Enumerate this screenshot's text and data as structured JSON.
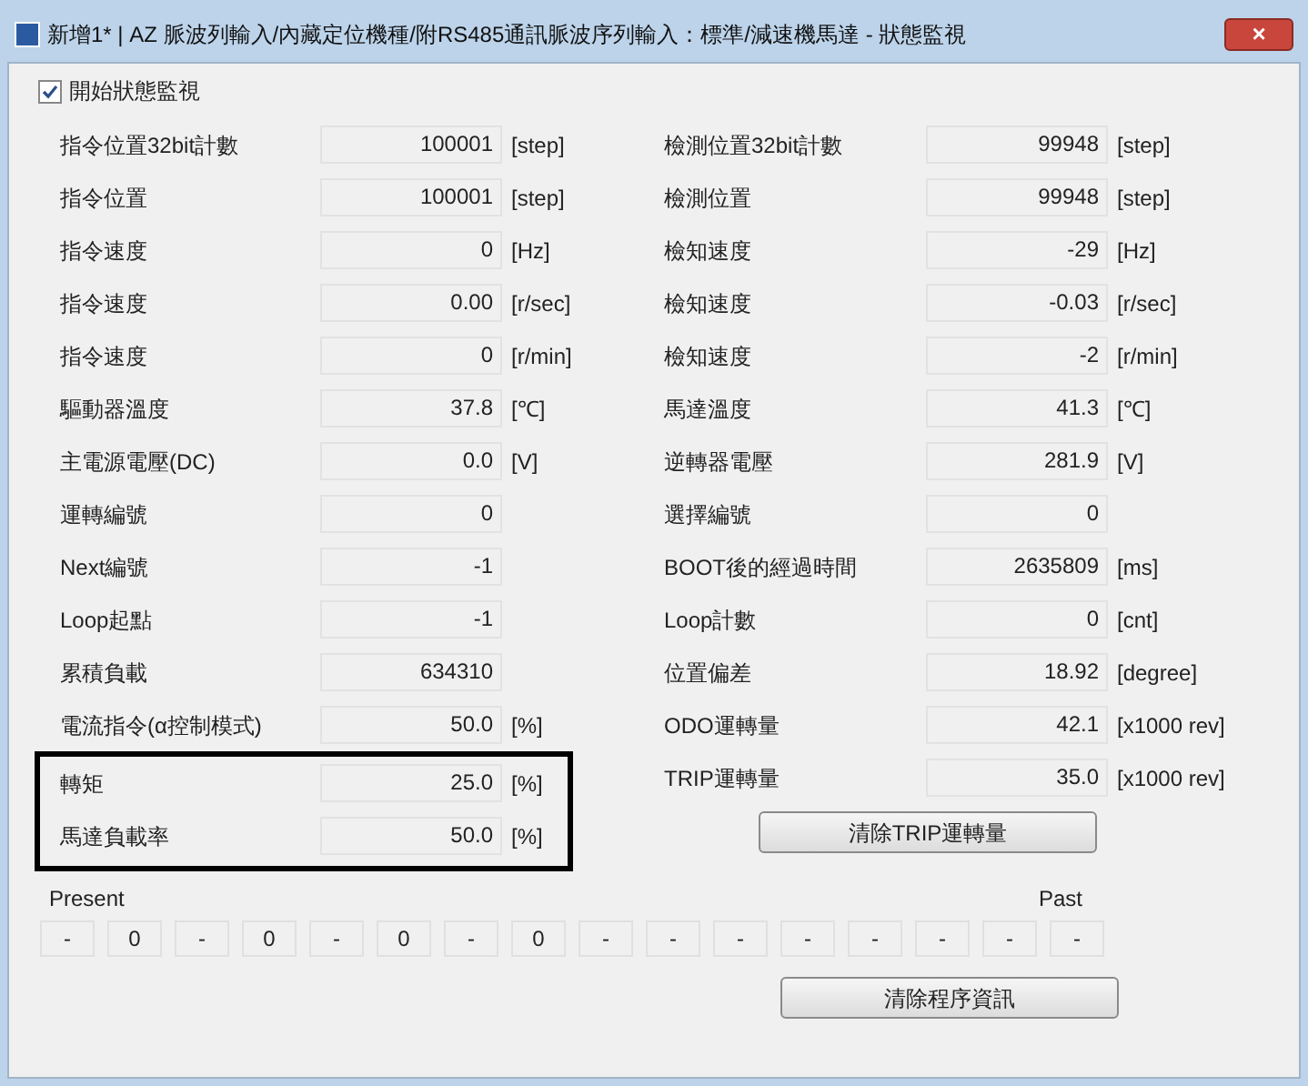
{
  "window": {
    "title": "新增1* | AZ 脈波列輸入/內藏定位機種/附RS485通訊脈波序列輸入：標準/減速機馬達 - 狀態監視",
    "close": "×"
  },
  "monitor_checkbox": {
    "label": "開始狀態監視",
    "checked": true
  },
  "left_rows": [
    {
      "label": "指令位置32bit計數",
      "value": "100001",
      "unit": "[step]",
      "highlighted": false
    },
    {
      "label": "指令位置",
      "value": "100001",
      "unit": "[step]",
      "highlighted": false
    },
    {
      "label": "指令速度",
      "value": "0",
      "unit": "[Hz]",
      "highlighted": false
    },
    {
      "label": "指令速度",
      "value": "0.00",
      "unit": "[r/sec]",
      "highlighted": false
    },
    {
      "label": "指令速度",
      "value": "0",
      "unit": "[r/min]",
      "highlighted": false
    },
    {
      "label": "驅動器溫度",
      "value": "37.8",
      "unit": "[℃]",
      "highlighted": false
    },
    {
      "label": "主電源電壓(DC)",
      "value": "0.0",
      "unit": "[V]",
      "highlighted": false
    },
    {
      "label": "運轉編號",
      "value": "0",
      "highlighted": false
    },
    {
      "label": "Next編號",
      "value": "-1",
      "highlighted": false
    },
    {
      "label": "Loop起點",
      "value": "-1",
      "highlighted": false
    },
    {
      "label": "累積負載",
      "value": "634310",
      "highlighted": false
    },
    {
      "label": "電流指令(α控制模式)",
      "value": "50.0",
      "unit": "[%]",
      "highlighted": false
    },
    {
      "label": "轉矩",
      "value": "25.0",
      "unit": "[%]",
      "highlighted": true
    },
    {
      "label": "馬達負載率",
      "value": "50.0",
      "unit": "[%]",
      "highlighted": true
    }
  ],
  "right_rows": [
    {
      "label": "檢測位置32bit計數",
      "value": "99948",
      "unit": "[step]"
    },
    {
      "label": "檢測位置",
      "value": "99948",
      "unit": "[step]"
    },
    {
      "label": "檢知速度",
      "value": "-29",
      "unit": "[Hz]"
    },
    {
      "label": "檢知速度",
      "value": "-0.03",
      "unit": "[r/sec]"
    },
    {
      "label": "檢知速度",
      "value": "-2",
      "unit": "[r/min]"
    },
    {
      "label": "馬達溫度",
      "value": "41.3",
      "unit": "[℃]"
    },
    {
      "label": "逆轉器電壓",
      "value": "281.9",
      "unit": "[V]"
    },
    {
      "label": "選擇編號",
      "value": "0"
    },
    {
      "label": "BOOT後的經過時間",
      "value": "2635809",
      "unit": "[ms]"
    },
    {
      "label": "Loop計數",
      "value": "0",
      "unit": "[cnt]"
    },
    {
      "label": "位置偏差",
      "value": "18.92",
      "unit": "[degree]"
    },
    {
      "label": "ODO運轉量",
      "value": "42.1",
      "unit": "[x1000 rev]"
    },
    {
      "label": "TRIP運轉量",
      "value": "35.0",
      "unit": "[x1000 rev]"
    }
  ],
  "clear_trip_button": "清除TRIP運轉量",
  "history": {
    "present_label": "Present",
    "past_label": "Past",
    "cells": [
      "-",
      "0",
      "-",
      "0",
      "-",
      "0",
      "-",
      "0",
      "-",
      "-",
      "-",
      "-",
      "-",
      "-",
      "-",
      "-"
    ]
  },
  "clear_history_button": "清除程序資訊"
}
